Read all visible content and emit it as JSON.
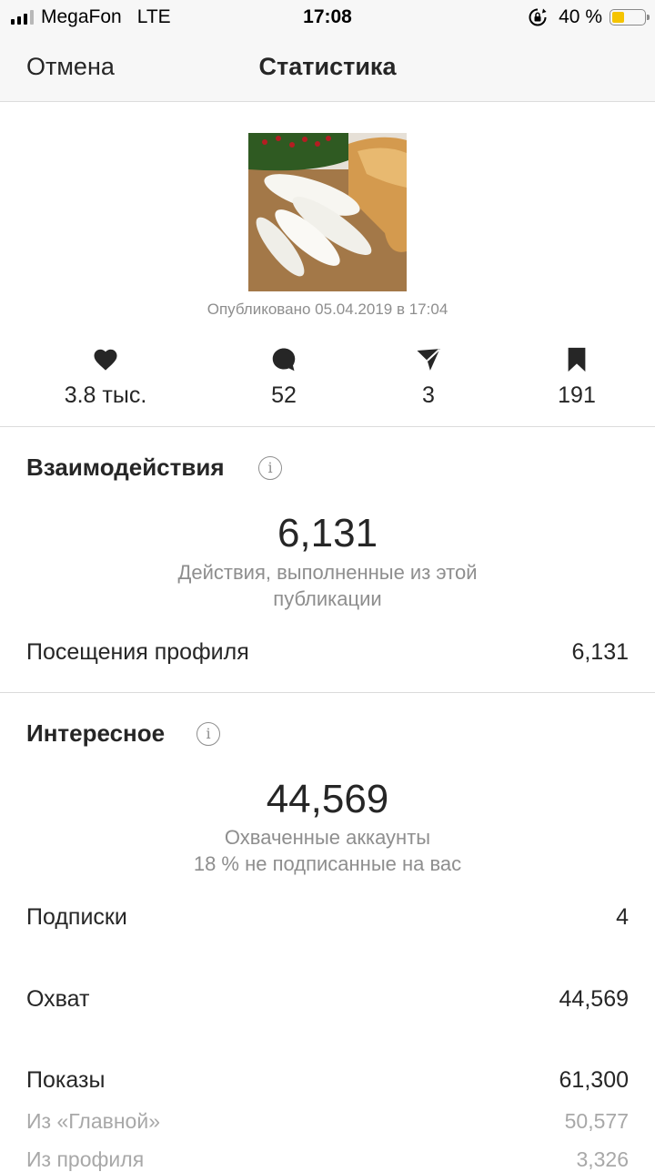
{
  "status_bar": {
    "carrier": "MegaFon",
    "network": "LTE",
    "time": "17:08",
    "battery": "40 %",
    "battery_color": "#f5c400"
  },
  "nav": {
    "cancel": "Отмена",
    "title": "Статистика"
  },
  "post": {
    "image": "cheese-and-pastries-photo",
    "published": "Опубликовано 05.04.2019 в 17:04"
  },
  "stats": {
    "likes": "3.8 тыс.",
    "comments": "52",
    "shares": "3",
    "saves": "191"
  },
  "interactions": {
    "title": "Взаимодействия",
    "total": "6,131",
    "caption_line1": "Действия, выполненные из этой",
    "caption_line2": "публикации",
    "rows": [
      {
        "label": "Посещения профиля",
        "value": "6,131"
      }
    ]
  },
  "discovery": {
    "title": "Интересное",
    "total": "44,569",
    "caption_line1": "Охваченные аккаунты",
    "caption_line2": "18 % не подписанные на вас",
    "rows": [
      {
        "label": "Подписки",
        "value": "4"
      },
      {
        "label": "Охват",
        "value": "44,569"
      },
      {
        "label": "Показы",
        "value": "61,300"
      }
    ],
    "sub_rows": [
      {
        "label": "Из «Главной»",
        "value": "50,577"
      },
      {
        "label": "Из профиля",
        "value": "3,326"
      }
    ]
  }
}
